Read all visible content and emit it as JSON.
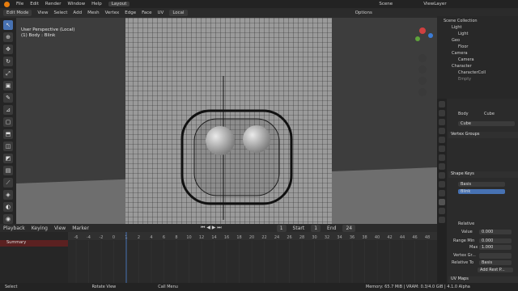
{
  "menu": {
    "file": "File",
    "edit": "Edit",
    "render": "Render",
    "window": "Window",
    "help": "Help",
    "workspace": "Layout",
    "scene": "Scene",
    "view_layer": "ViewLayer"
  },
  "vp_header": {
    "mode": "Edit Mode",
    "view": "View",
    "select": "Select",
    "add": "Add",
    "mesh": "Mesh",
    "vertex": "Vertex",
    "edge": "Edge",
    "face": "Face",
    "uv": "UV",
    "orientation": "Local",
    "options": "Options"
  },
  "viewport": {
    "line1": "User Perspective (Local)",
    "line2": "(1) Body : Blink"
  },
  "outliner": {
    "title": "Scene Collection",
    "items": [
      "Light",
      "Light",
      "Geo",
      "Floor",
      "Camera",
      "Camera",
      "Character",
      "CharacterColl",
      "Empty"
    ]
  },
  "props": {
    "breadcrumb_object": "Body",
    "breadcrumb_mesh": "Cube",
    "mesh_name": "Cube",
    "vertex_groups": "Vertex Groups",
    "shape_keys": "Shape Keys",
    "key_basis": "Basis",
    "key_blink": "Blink",
    "relative": "Relative",
    "value_label": "Value",
    "value": "0.000",
    "range_min_label": "Range Min",
    "range_min": "0.000",
    "max_label": "Max",
    "max": "1.000",
    "vertex_group_label": "Vertex Gr...",
    "relative_to_label": "Relative To",
    "relative_to": "Basis",
    "add_rest": "Add Rest P...",
    "uv_maps": "UV Maps"
  },
  "timeline": {
    "playback": "Playback",
    "keying": "Keying",
    "view": "View",
    "marker": "Marker",
    "current_frame": "1",
    "start_label": "Start",
    "start": "1",
    "end_label": "End",
    "end": "24",
    "summary": "Summary",
    "ticks": [
      "-6",
      "-4",
      "-2",
      "0",
      "1",
      "2",
      "4",
      "6",
      "8",
      "10",
      "12",
      "14",
      "16",
      "18",
      "20",
      "22",
      "24",
      "26",
      "28",
      "30",
      "32",
      "34",
      "36",
      "38",
      "40",
      "42",
      "44",
      "46",
      "48"
    ]
  },
  "status": {
    "select": "Select",
    "rotate": "Rotate View",
    "call_menu": "Call Menu",
    "memory": "Memory: 65.7 MiB | VRAM: 0.3/4.0 GiB | 4.1.0 Alpha"
  }
}
